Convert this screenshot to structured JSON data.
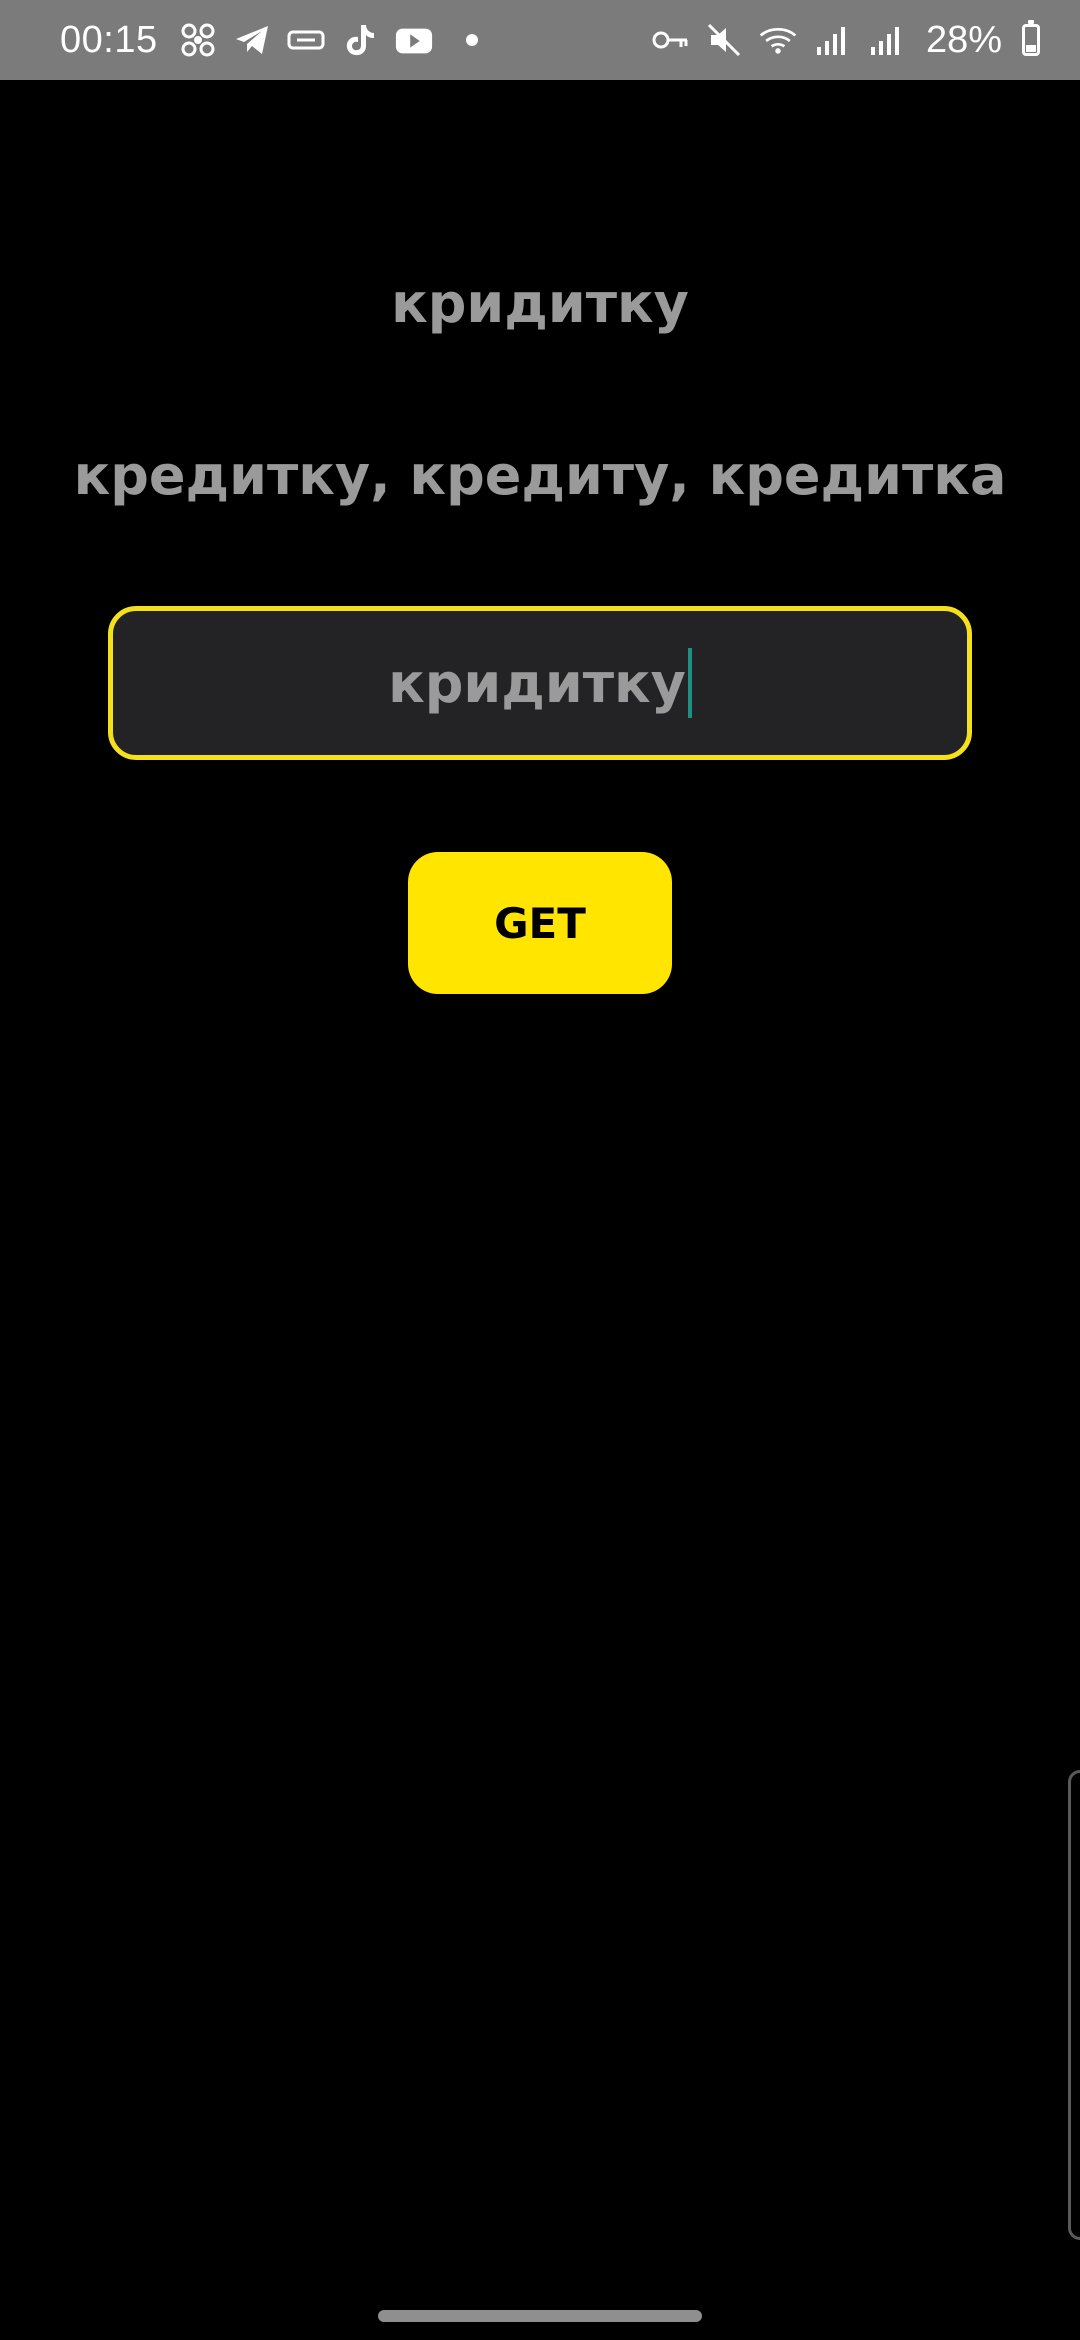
{
  "status_bar": {
    "time": "00:15",
    "battery": "28%",
    "battery_level": 0.28,
    "left_icons": [
      "fan-icon",
      "telegram-icon",
      "vpn-icon",
      "tiktok-icon",
      "youtube-icon",
      "notification-dot"
    ],
    "right_icons": [
      "key-icon",
      "mute-icon",
      "wifi-icon",
      "signal-icon",
      "signal-icon"
    ]
  },
  "word": "кридитку",
  "suggestions": "кредитку, кредиту, кредитка",
  "input": {
    "value": "кридитку"
  },
  "button": {
    "label": "GET"
  },
  "colors": {
    "background": "#000000",
    "accent": "#ffe500",
    "input_border": "#f5e11b",
    "text": "#9a9a9a",
    "caret": "#1e8f80"
  }
}
